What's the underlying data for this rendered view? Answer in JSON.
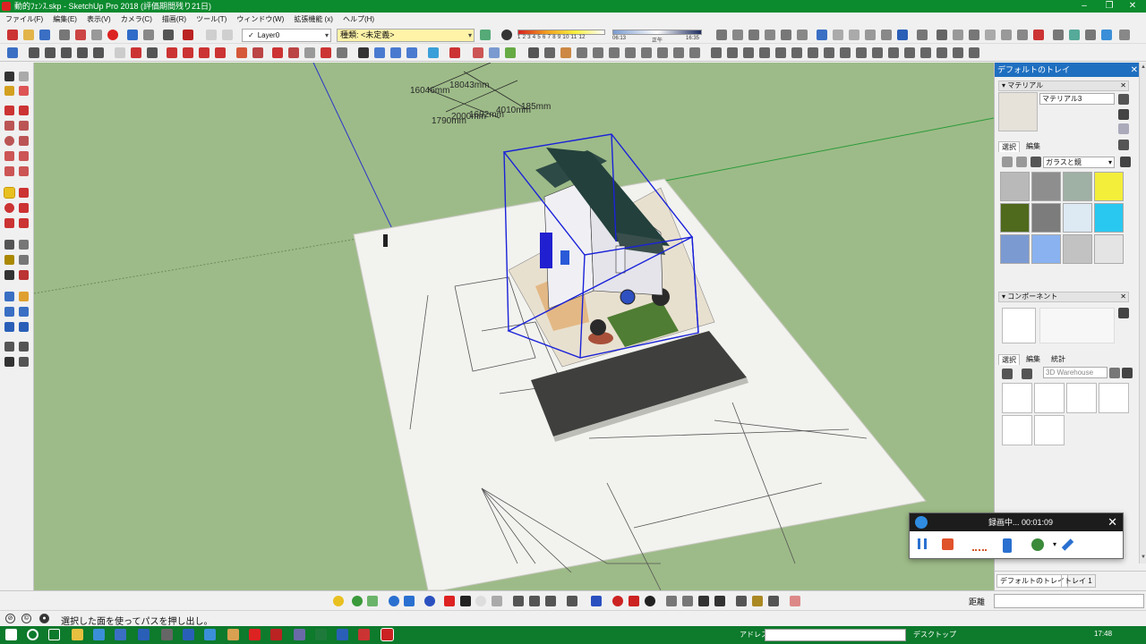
{
  "window": {
    "title": "動的ﾌｪﾝｽ.skp - SketchUp Pro 2018 (評価期間残り21日)",
    "controls": [
      "–",
      "❐",
      "✕"
    ]
  },
  "menu": [
    "ファイル(F)",
    "編集(E)",
    "表示(V)",
    "カメラ(C)",
    "描画(R)",
    "ツール(T)",
    "ウィンドウ(W)",
    "拡張機能 (x)",
    "ヘルプ(H)"
  ],
  "toolbar": {
    "layer": "Layer0",
    "style": "種類: <未定義>",
    "shadow_scale": "1 2 3 4 5 6 7 8 9 10 11 12",
    "time_start": "06:13",
    "time_mid": "正午",
    "time_end": "16:35"
  },
  "viewport": {
    "dimensions": [
      "16046mm",
      "18043mm",
      "1790mm",
      "2000mm",
      "1692mm",
      "4010mm",
      "185mm"
    ],
    "colors": {
      "ground": "#9dbb88",
      "sheet": "#f2f2ef",
      "road": "#3f3f3d",
      "selection": "#1a22d8"
    }
  },
  "tray": {
    "title": "デフォルトのトレイ",
    "materials": {
      "section": "マテリアル",
      "name": "マテリアル3",
      "tab_select": "選択",
      "tab_edit": "編集",
      "library": "ガラスと鏡",
      "swatches": [
        "#b9b9b9",
        "#8e8e8e",
        "#9fb0a4",
        "#f3ee3a",
        "#4f6a1c",
        "#7c7c7c",
        "#dde9f3",
        "#29c8f0",
        "#7c9ad2",
        "#8ab2f0",
        "#c2c2c2",
        "#e4e4e4"
      ]
    },
    "components": {
      "section": "コンポーネント",
      "tab_select": "選択",
      "tab_edit": "編集",
      "tab_stats": "統計",
      "search": "3D Warehouse"
    },
    "bottom_tabs": [
      "デフォルトのトレイ",
      "トレイ 1"
    ]
  },
  "recorder": {
    "status": "録画中... 00:01:09",
    "close": "✕"
  },
  "bottombar": {
    "measure_label": "距離"
  },
  "statusbar": {
    "text": "選択した面を使ってパスを押し出し。"
  },
  "taskbar": {
    "address_label": "アドレス",
    "desktop": "デスクトップ",
    "clock": "17:48"
  }
}
